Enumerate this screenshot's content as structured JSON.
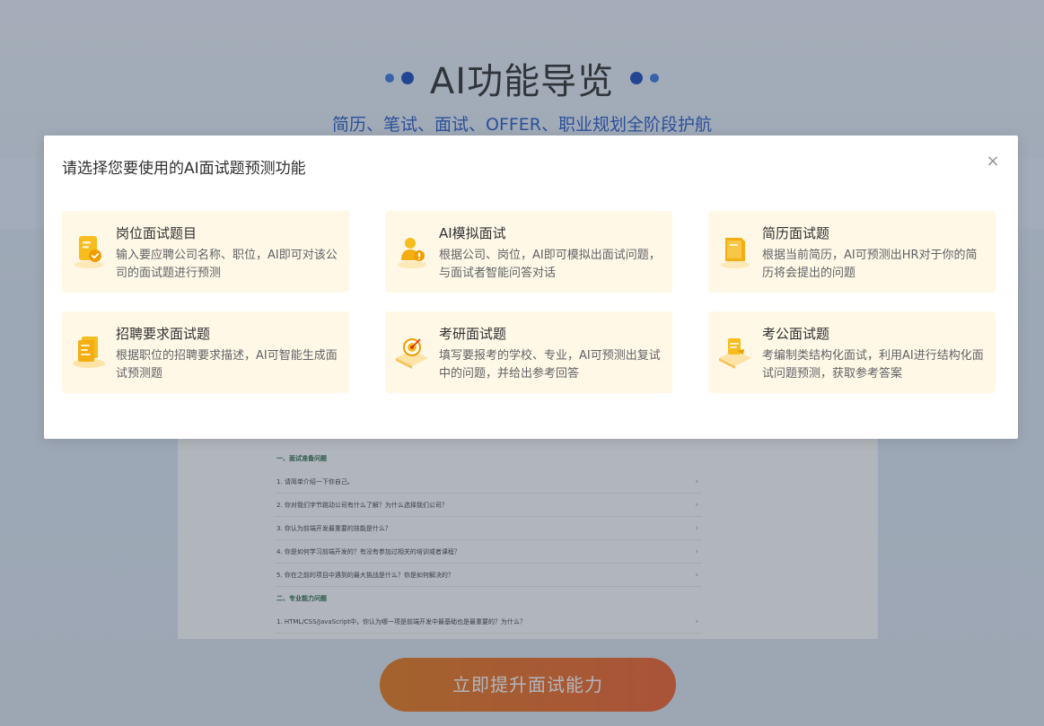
{
  "background": {
    "title": "AI功能导览",
    "subtitle": "简历、笔试、面试、OFFER、职业规划全阶段护航",
    "doc_rows": [
      {
        "text": "一、面试准备问题",
        "section": true
      },
      {
        "text": "1. 请简单介绍一下你自己。",
        "section": false
      },
      {
        "text": "2. 你对我们字节跳动公司有什么了解？为什么选择我们公司？",
        "section": false
      },
      {
        "text": "3. 你认为前端开发最重要的技能是什么？",
        "section": false
      },
      {
        "text": "4. 你是如何学习前端开发的？有没有参加过相关的培训或者课程？",
        "section": false
      },
      {
        "text": "5. 你在之前的项目中遇到的最大挑战是什么？你是如何解决的？",
        "section": false
      },
      {
        "text": "二、专业能力问题",
        "section": true
      },
      {
        "text": "1. HTML/CSS/JavaScript中，你认为哪一项是前端开发中最基础也是最重要的？为什么？",
        "section": false
      }
    ],
    "cta_label": "立即提升面试能力"
  },
  "dialog": {
    "title": "请选择您要使用的AI面试题预测功能",
    "close_icon": "×",
    "cards": [
      {
        "icon": "clipboard-check-icon",
        "title": "岗位面试题目",
        "desc": "输入要应聘公司名称、职位，AI即可对该公司的面试题进行预测"
      },
      {
        "icon": "interviewer-icon",
        "title": "AI模拟面试",
        "desc": "根据公司、岗位，AI即可模拟出面试问题，与面试者智能问答对话"
      },
      {
        "icon": "resume-folder-icon",
        "title": "简历面试题",
        "desc": "根据当前简历，AI可预测出HR对于你的简历将会提出的问题"
      },
      {
        "icon": "document-stack-icon",
        "title": "招聘要求面试题",
        "desc": "根据职位的招聘要求描述，AI可智能生成面试预测题"
      },
      {
        "icon": "target-icon",
        "title": "考研面试题",
        "desc": "填写要报考的学校、专业，AI可预测出复试中的问题，并给出参考回答"
      },
      {
        "icon": "civil-exam-icon",
        "title": "考公面试题",
        "desc": "考编制类结构化面试，利用AI进行结构化面试问题预测，获取参考答案"
      }
    ]
  },
  "colors": {
    "accent_blue": "#1b4fc4",
    "card_bg": "#fff8e6",
    "icon_orange": "#f5b400",
    "cta_orange": "#ee6516"
  }
}
